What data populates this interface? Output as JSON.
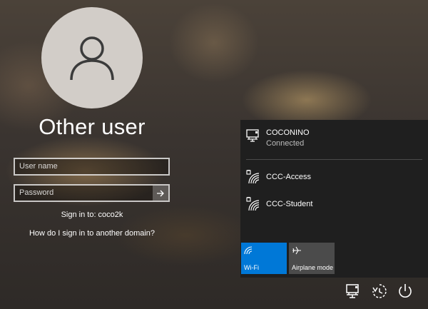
{
  "login": {
    "title": "Other user",
    "username_placeholder": "User name",
    "password_placeholder": "Password",
    "sign_in_to": "Sign in to: coco2k",
    "other_domain_link": "How do I sign in to another domain?"
  },
  "network_panel": {
    "connected": {
      "name": "COCONINO",
      "status": "Connected"
    },
    "networks": [
      {
        "name": "CCC-Access"
      },
      {
        "name": "CCC-Student"
      }
    ],
    "tiles": {
      "wifi": "Wi-Fi",
      "airplane": "Airplane mode"
    }
  },
  "colors": {
    "accent": "#0078d7",
    "panel_bg": "#1f1f1f",
    "tile_inactive": "#4b4b4b"
  },
  "icons": [
    "user-icon",
    "arrow-right-icon",
    "ethernet-icon",
    "wifi-secured-icon",
    "airplane-icon",
    "network-icon",
    "ease-of-access-icon",
    "power-icon"
  ]
}
